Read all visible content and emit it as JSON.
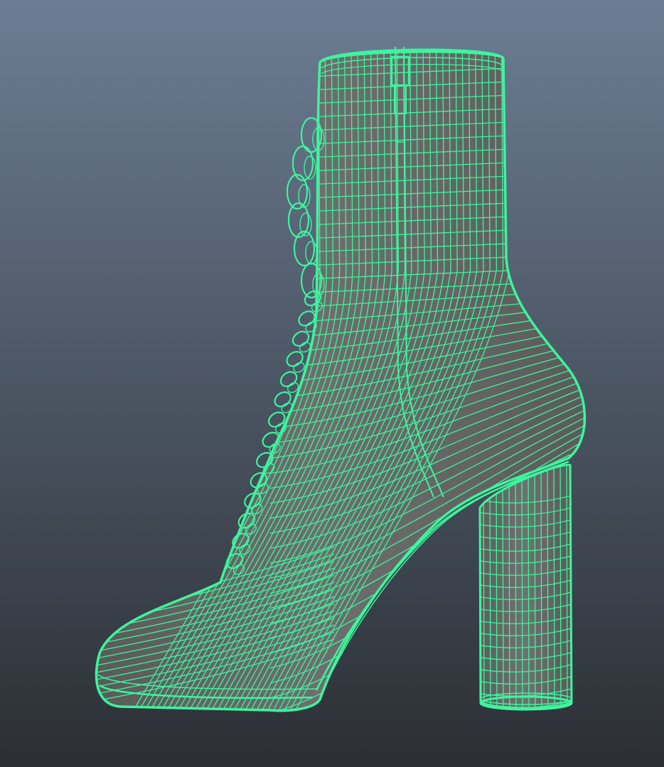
{
  "viewport": {
    "panel": "perspective-viewport",
    "background_top": "#6C7D93",
    "background_bottom": "#2B2F34",
    "wire_color": "#3CF59E",
    "wire_highlight": "#6FFFC2",
    "surface_color": "#6A6A6A",
    "surface_shadow": "#555555",
    "display_mode": "wireframe-on-shaded",
    "selection_state": "selected"
  },
  "model": {
    "object_icon": "mesh-icon",
    "parts": [
      "boot-shaft",
      "boot-vamp",
      "boot-toe",
      "boot-sole",
      "boot-heel",
      "boot-laces",
      "boot-zipper"
    ]
  }
}
